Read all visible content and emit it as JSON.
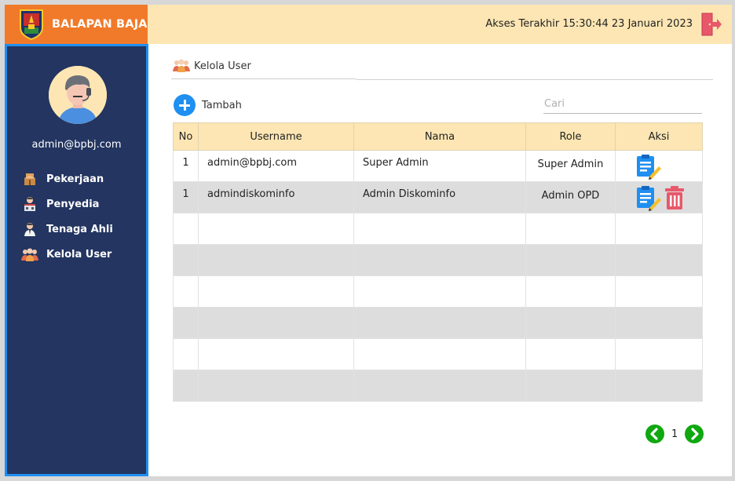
{
  "brand": {
    "title": "BALAPAN BAJA",
    "logo_icon": "emblem-shield-icon"
  },
  "header": {
    "access_text": "Akses Terakhir 15:30:44 23 Januari 2023",
    "exit_icon": "logout-door-icon"
  },
  "sidebar": {
    "email": "admin@bpbj.com",
    "items": [
      {
        "label": "Pekerjaan",
        "icon": "box-stack-icon"
      },
      {
        "label": "Penyedia",
        "icon": "provider-icon"
      },
      {
        "label": "Tenaga Ahli",
        "icon": "expert-icon"
      },
      {
        "label": "Kelola User",
        "icon": "users-group-icon"
      }
    ]
  },
  "main": {
    "breadcrumb": "Kelola User",
    "add_label": "Tambah",
    "search_placeholder": "Cari",
    "table": {
      "headers": [
        "No",
        "Username",
        "Nama",
        "Role",
        "Aksi"
      ],
      "rows": [
        {
          "no": "1",
          "username": "admin@bpbj.com",
          "nama": "Super Admin",
          "role": "Super Admin",
          "actions": [
            "edit"
          ]
        },
        {
          "no": "1",
          "username": "admindiskominfo",
          "nama": "Admin Diskominfo",
          "role": "Admin OPD",
          "actions": [
            "edit",
            "delete"
          ]
        }
      ],
      "empty_rows": 6
    },
    "pagination": {
      "current_page": "1"
    }
  },
  "colors": {
    "brand": "#f07a2a",
    "header": "#fde6b3",
    "sidebar": "#233560",
    "accent": "#1f8ff0",
    "pager": "#10a810",
    "delete": "#e8586a"
  }
}
